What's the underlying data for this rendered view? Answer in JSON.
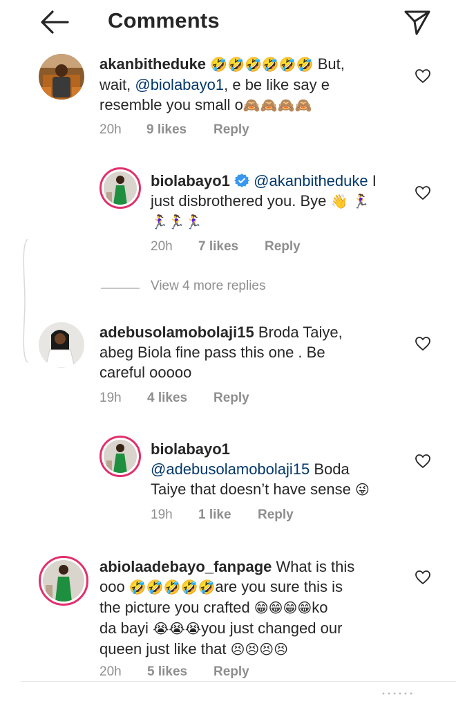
{
  "header": {
    "title": "Comments",
    "back_icon": "arrow-left-icon",
    "send_icon": "paper-plane-icon"
  },
  "comments": [
    {
      "username": "akanbitheduke",
      "pre": "",
      "emoji1": "🤣🤣🤣🤣🤣🤣",
      "line1_text": " But,",
      "line2_pre": "wait, ",
      "mention": "@biolabayo1",
      "line2_post": ", e be like say e",
      "line3_text": "resemble you small o",
      "emoji2": "🙈🙈🙈🙈",
      "time": "20h",
      "likes": "9 likes",
      "reply": "Reply"
    },
    {
      "username": "biolabayo1",
      "mention": "@akanbitheduke",
      "line1_post": " I",
      "line2_text": "just disbrothered you. Bye ",
      "emoji1": "👋 🏃‍♀️",
      "emoji2": "🏃‍♀️🏃‍♀️🏃‍♀️",
      "time": "20h",
      "likes": "7 likes",
      "reply": "Reply"
    },
    {
      "username": "adebusolamobolaji15",
      "line1_text": " Broda Taiye,",
      "line2_text": "abeg Biola fine pass this one . Be",
      "line3_text": "careful ooooo",
      "time": "19h",
      "likes": "4 likes",
      "reply": "Reply"
    },
    {
      "username": "biolabayo1",
      "mention": "@adebusolamobolaji15",
      "line2_post": " Boda",
      "line3_text": "Taiye that doesn’t have sense ",
      "emoji": "😜",
      "time": "19h",
      "likes": "1 like",
      "reply": "Reply"
    },
    {
      "username": "abiolaadebayo_fanpage",
      "line1_text": " What is this",
      "line2_pre": "ooo ",
      "emoji_a": "🤣🤣🤣🤣🤣",
      "line2_post": "are you sure this is",
      "line3_pre": "the picture you crafted ",
      "emoji_b": "😁😁😁😁",
      "line3_post": "ko",
      "line4_pre": "da bayi ",
      "emoji_c": "😭😭😭",
      "line4_post": "you just changed our",
      "line5_pre": "queen just like that ",
      "emoji_d": "😣😣😣😣",
      "time": "20h",
      "likes": "5 likes",
      "reply": "Reply"
    }
  ],
  "view_more": "View 4 more replies",
  "icons": {
    "heart": "heart-outline-icon",
    "verified": "verified-badge-icon"
  },
  "colors": {
    "text": "#262626",
    "muted": "#8e8e8e",
    "mention": "#00376b",
    "verified": "#3897f0",
    "story_ring": "#e1306c"
  }
}
